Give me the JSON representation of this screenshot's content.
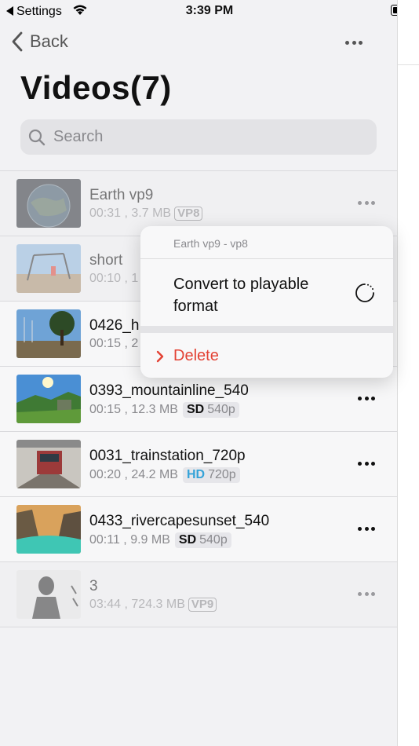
{
  "status_bar": {
    "back_app": "Settings",
    "time": "3:39 PM"
  },
  "nav": {
    "back_label": "Back"
  },
  "page": {
    "title": "Videos(7)"
  },
  "search": {
    "placeholder": "Search"
  },
  "videos": [
    {
      "title": "Earth vp9",
      "duration": "00:31",
      "size": "3.7 MB",
      "codec": "VP8",
      "dimmed": true
    },
    {
      "title": "short",
      "duration": "00:10",
      "size": "1",
      "dimmed": true
    },
    {
      "title": "0426_h",
      "duration": "00:15",
      "size": "2",
      "dimmed": false
    },
    {
      "title": "0393_mountainline_540",
      "duration": "00:15",
      "size": "12.3 MB",
      "quality": "SD",
      "resolution": "540p",
      "dimmed": false
    },
    {
      "title": "0031_trainstation_720p",
      "duration": "00:20",
      "size": "24.2 MB",
      "quality": "HD",
      "resolution": "720p",
      "dimmed": false
    },
    {
      "title": "0433_rivercapesunset_540",
      "duration": "00:11",
      "size": "9.9 MB",
      "quality": "SD",
      "resolution": "540p",
      "dimmed": false
    },
    {
      "title": "3",
      "duration": "03:44",
      "size": "724.3 MB",
      "codec": "VP9",
      "dimmed": true
    }
  ],
  "context_menu": {
    "header": "Earth vp9 - vp8",
    "convert_label": "Convert to playable format",
    "delete_label": "Delete"
  },
  "colors": {
    "hd": "#35a3d8",
    "delete": "#e34234",
    "accent_gray": "#8a8a8e"
  },
  "icons": [
    "wifi-icon",
    "battery-icon",
    "back-chevron-icon",
    "more-icon",
    "search-icon",
    "spinner-icon",
    "chevron-right-icon"
  ]
}
